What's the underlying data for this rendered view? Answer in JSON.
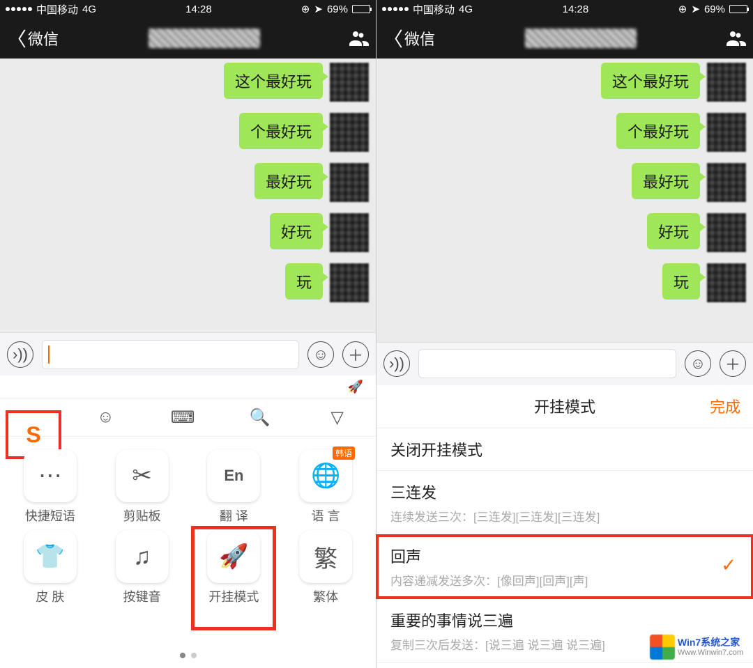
{
  "status": {
    "carrier": "中国移动",
    "network": "4G",
    "time": "14:28",
    "battery_pct": "69%",
    "battery_fill": "69%"
  },
  "nav": {
    "back_label": "微信"
  },
  "messages": [
    "这个最好玩",
    "个最好玩",
    "最好玩",
    "好玩",
    "玩"
  ],
  "left_toolbar": {
    "sogou": "S"
  },
  "tools": {
    "row1": [
      {
        "label": "快捷短语",
        "glyph": "💬"
      },
      {
        "label": "剪贴板",
        "glyph": "✂"
      },
      {
        "label": "翻 译",
        "glyph": "En"
      },
      {
        "label": "语 言",
        "glyph": "🌐",
        "badge": "韩语"
      }
    ],
    "row2": [
      {
        "label": "皮 肤",
        "glyph": "👕"
      },
      {
        "label": "按键音",
        "glyph": "♫"
      },
      {
        "label": "开挂模式",
        "glyph": "🚀",
        "highlight": true
      },
      {
        "label": "繁体",
        "glyph": "繁"
      }
    ]
  },
  "right_panel": {
    "title": "开挂模式",
    "done": "完成",
    "items": [
      {
        "title": "关闭开挂模式",
        "sub": ""
      },
      {
        "title": "三连发",
        "sub": "连续发送三次：[三连发][三连发][三连发]"
      },
      {
        "title": "回声",
        "sub": "内容递减发送多次：[像回声][回声][声]",
        "selected": true,
        "highlight": true
      },
      {
        "title": "重要的事情说三遍",
        "sub": "复制三次后发送：[说三遍 说三遍 说三遍]"
      }
    ]
  },
  "watermark": {
    "brand": "Win7系统之家",
    "url": "Www.Winwin7.com"
  }
}
